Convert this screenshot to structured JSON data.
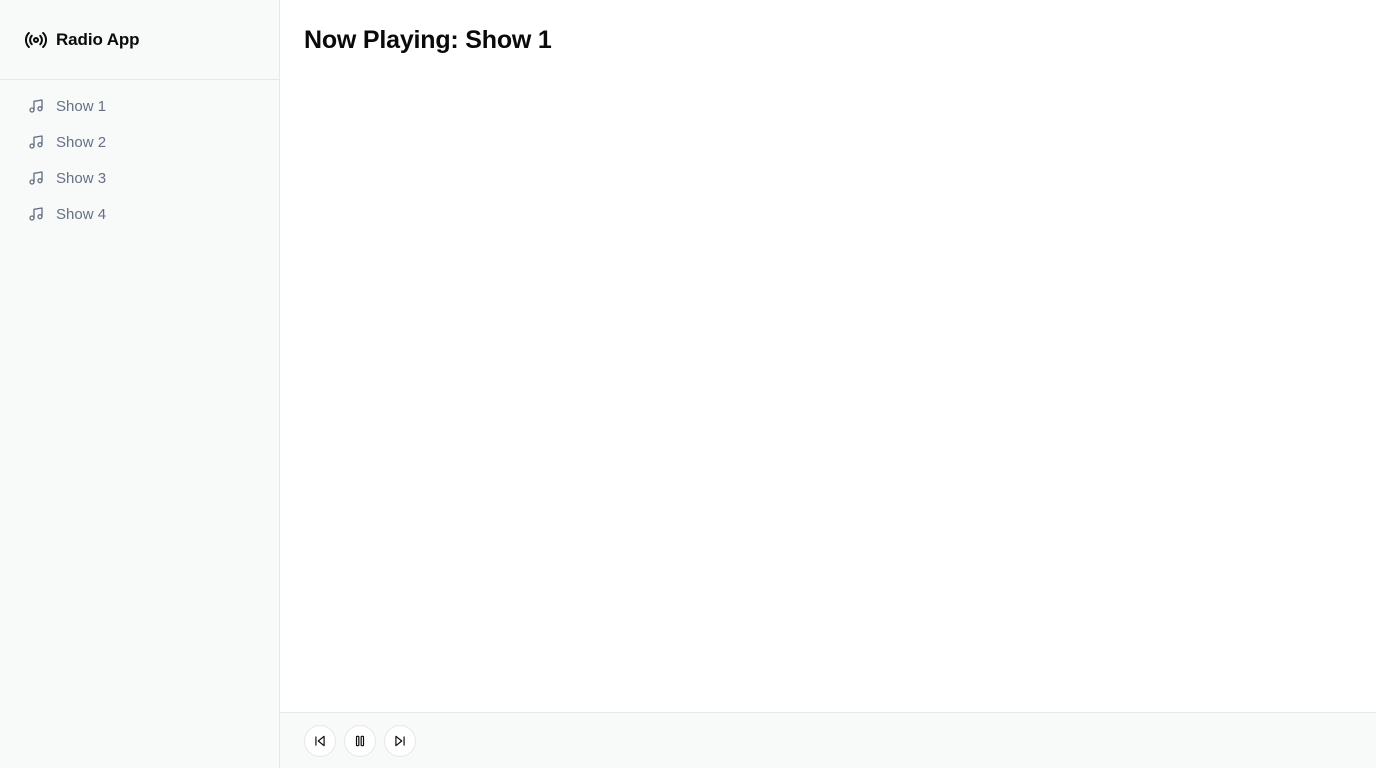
{
  "app": {
    "title": "Radio App",
    "brand_icon": "radio-broadcast-icon"
  },
  "sidebar": {
    "items": [
      {
        "label": "Show 1",
        "icon": "music-note-icon"
      },
      {
        "label": "Show 2",
        "icon": "music-note-icon"
      },
      {
        "label": "Show 3",
        "icon": "music-note-icon"
      },
      {
        "label": "Show 4",
        "icon": "music-note-icon"
      }
    ]
  },
  "main": {
    "title": "Now Playing: Show 1"
  },
  "player": {
    "controls": [
      {
        "action": "previous",
        "icon": "skip-back-icon"
      },
      {
        "action": "pause",
        "icon": "pause-icon"
      },
      {
        "action": "next",
        "icon": "skip-forward-icon"
      }
    ]
  },
  "colors": {
    "sidebar_bg": "#f8fafa",
    "border": "#e5e7eb",
    "text_primary": "#0a0a0a",
    "text_muted": "#667085"
  }
}
